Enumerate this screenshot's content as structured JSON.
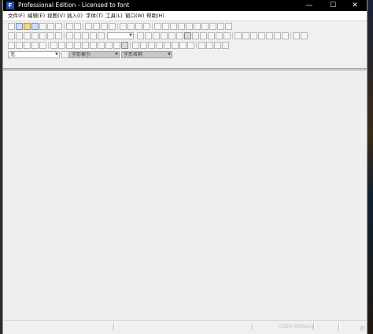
{
  "window": {
    "title": "Professional Edition - Licensed to font",
    "icon": "app-icon",
    "controls": {
      "minimize": "—",
      "maximize": "☐",
      "close": "✕"
    }
  },
  "menubar": {
    "items": [
      {
        "label": "文件(F)"
      },
      {
        "label": "编辑(E)"
      },
      {
        "label": "视图(V)"
      },
      {
        "label": "插入(I)"
      },
      {
        "label": "字体(T)"
      },
      {
        "label": "工具(L)"
      },
      {
        "label": "窗口(W)"
      },
      {
        "label": "帮助(H)"
      }
    ]
  },
  "toolbar": {
    "font_combo": {
      "value": "无"
    },
    "glyph_index_combo": {
      "value": "字形索引"
    },
    "glyph_name_combo": {
      "value": "字形名称"
    }
  },
  "statusbar": {
    "watermark": "CSDN @Zhang"
  }
}
